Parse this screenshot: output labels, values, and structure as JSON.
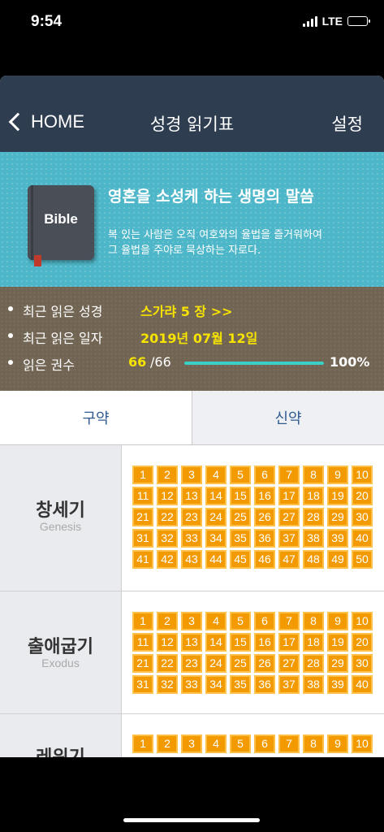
{
  "status": {
    "time": "9:54",
    "network": "LTE"
  },
  "nav": {
    "back_label": "HOME",
    "title": "성경 읽기표",
    "settings_label": "설정"
  },
  "banner": {
    "book_label": "Bible",
    "title": "영혼을 소성케 하는 생명의 말씀",
    "verse_line1": "복 있는 사람은 오직 여호와의 율법을 즐거워하여",
    "verse_line2": "그 율법을 주야로 묵상하는 자로다."
  },
  "stats": {
    "recent_book_label": "최근 읽은 성경",
    "recent_book_value": "스가랴 5 장 >>",
    "recent_date_label": "최근 읽은 일자",
    "recent_date_value": "2019년 07월 12일",
    "read_count_label": "읽은 권수",
    "read_count": "66",
    "total_count": "/66",
    "progress_fraction": 1.0,
    "percent": "100%"
  },
  "tabs": {
    "old_testament": "구약",
    "new_testament": "신약"
  },
  "books": [
    {
      "name_ko": "창세기",
      "name_en": "Genesis",
      "chapters": 50
    },
    {
      "name_ko": "출애굽기",
      "name_en": "Exodus",
      "chapters": 40
    },
    {
      "name_ko": "레위기",
      "name_en": "",
      "chapters": 10
    }
  ],
  "colors": {
    "nav": "#2e3d50",
    "banner": "#4db6c8",
    "stats": "#716453",
    "accent_yellow": "#f7e300",
    "chapter": "#f29a00"
  }
}
